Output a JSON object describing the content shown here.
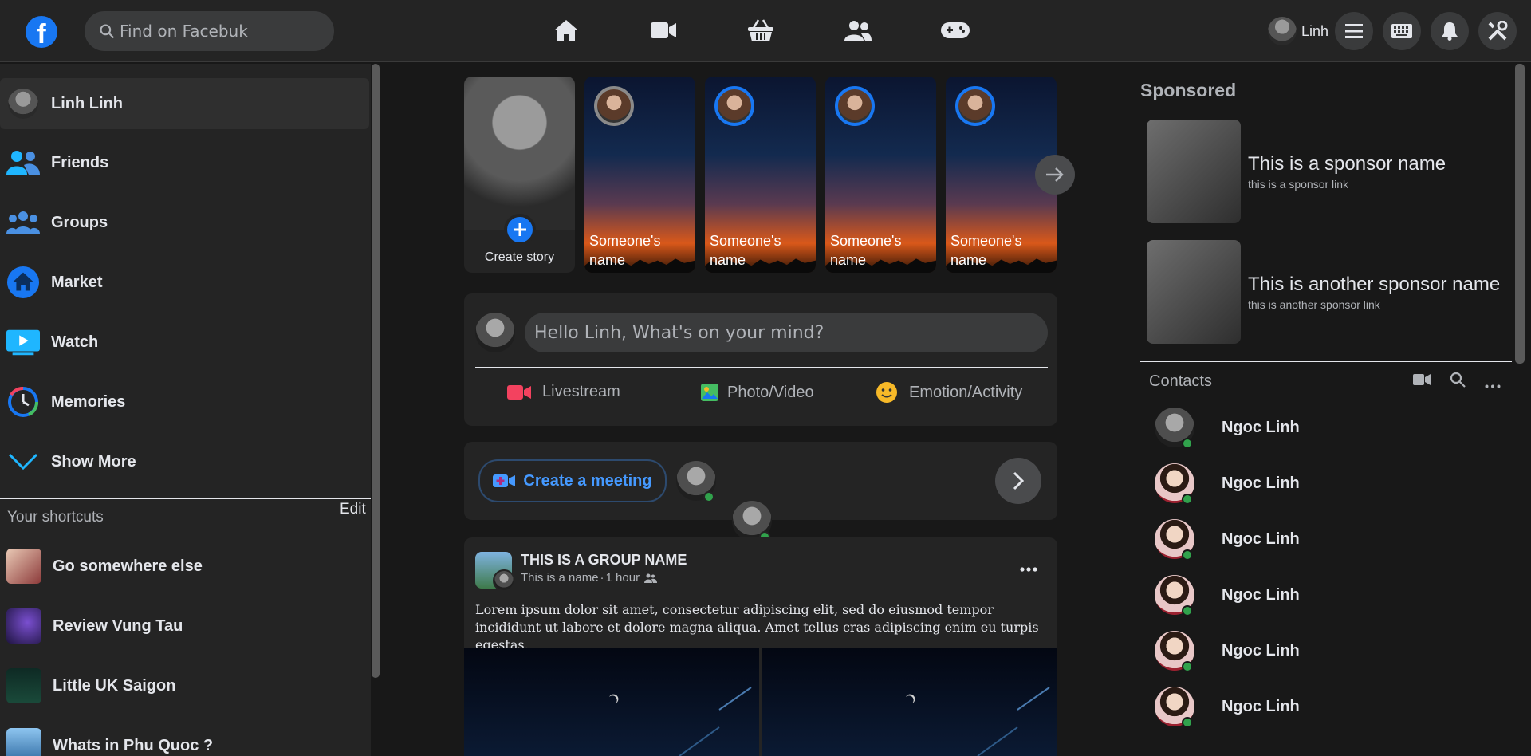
{
  "header": {
    "search_placeholder": "Find on Facebuk",
    "nav": [
      "home-icon",
      "video-icon",
      "marketplace-basket-icon",
      "groups-icon",
      "gaming-icon"
    ],
    "profile_name": "Linh",
    "actions": [
      "menu-icon",
      "keyboard-icon",
      "bell-icon",
      "tools-icon"
    ]
  },
  "sidebar": {
    "profile_name": "Linh Linh",
    "items": [
      {
        "label": "Friends",
        "icon": "friends-icon"
      },
      {
        "label": "Groups",
        "icon": "groups-icon"
      },
      {
        "label": "Market",
        "icon": "market-icon"
      },
      {
        "label": "Watch",
        "icon": "watch-icon"
      },
      {
        "label": "Memories",
        "icon": "memories-icon"
      },
      {
        "label": "Show More",
        "icon": "chevron-down-icon"
      }
    ],
    "shortcuts_title": "Your shortcuts",
    "shortcuts_edit": "Edit",
    "shortcuts": [
      {
        "label": "Go somewhere else"
      },
      {
        "label": "Review Vung Tau"
      },
      {
        "label": "Little UK Saigon"
      },
      {
        "label": "Whats in Phu Quoc ?"
      }
    ]
  },
  "stories": {
    "create_label": "Create story",
    "items": [
      {
        "name": "Someone's name"
      },
      {
        "name": "Someone's name"
      },
      {
        "name": "Someone's name"
      },
      {
        "name": "Someone's name"
      }
    ]
  },
  "composer": {
    "placeholder": "Hello Linh, What's on your mind?",
    "actions": [
      {
        "label": "Livestream",
        "color": "#f3425f"
      },
      {
        "label": "Photo/Video",
        "color": "#45bd62"
      },
      {
        "label": "Emotion/Activity",
        "color": "#f7b928"
      }
    ]
  },
  "rooms": {
    "create_label": "Create a meeting"
  },
  "post": {
    "group_name": "THIS IS A GROUP NAME",
    "author": "This is a name",
    "separator": "·",
    "time": "1 hour",
    "body": "Lorem ipsum dolor sit amet, consectetur adipiscing elit, sed do eiusmod tempor incididunt ut labore et dolore magna aliqua. Amet tellus cras adipiscing enim eu turpis egestas."
  },
  "sponsored": {
    "title": "Sponsored",
    "items": [
      {
        "name": "This is a sponsor name",
        "link": "this is a sponsor link"
      },
      {
        "name": "This is another sponsor name",
        "link": "this is another sponsor link"
      }
    ]
  },
  "contacts": {
    "title": "Contacts",
    "items": [
      {
        "name": "Ngoc Linh"
      },
      {
        "name": "Ngoc Linh"
      },
      {
        "name": "Ngoc Linh"
      },
      {
        "name": "Ngoc Linh"
      },
      {
        "name": "Ngoc Linh"
      },
      {
        "name": "Ngoc Linh"
      }
    ]
  },
  "colors": {
    "accent": "#1877f2",
    "online": "#31a24c",
    "bg": "#181818",
    "panel": "#242424"
  }
}
